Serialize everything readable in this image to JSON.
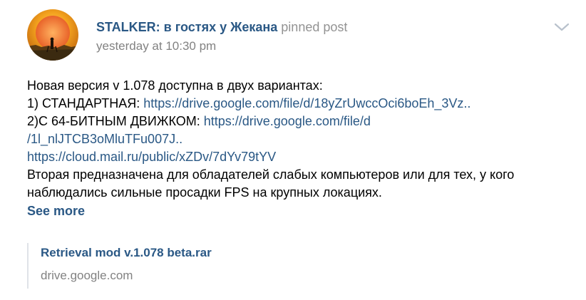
{
  "post": {
    "author": "STALKER: в гостях у Жекана",
    "pinned_label": "pinned post",
    "date": "yesterday at 10:30 pm",
    "avatar_icon": "group-avatar-icon",
    "menu_icon": "chevron-down-icon",
    "lines": [
      {
        "text": "Новая версия v 1.078 доступна в двух вариантах:"
      },
      {
        "text": "1) СТАНДАРТНАЯ: ",
        "link": "https://drive.google.com/file/d/18yZrUwccOci6boEh_3Vz.."
      },
      {
        "text": "2)С 64-БИТНЫМ ДВИЖКОМ: ",
        "link": "https://drive.google.com/file/d"
      },
      {
        "text": "",
        "link": "/1l_nlJTCB3oMluTFu007J.."
      },
      {
        "text": "",
        "link": "https://cloud.mail.ru/public/xZDv/7dYv79tYV"
      },
      {
        "text": "Вторая предназначена для обладателей слабых компьютеров или для тех, у кого"
      },
      {
        "text": "наблюдались сильные просадки FPS на крупных локациях."
      }
    ],
    "see_more": "See more",
    "attachment": {
      "title": "Retrieval mod v.1.078 beta.rar",
      "domain": "drive.google.com"
    }
  },
  "colors": {
    "link": "#2a5885",
    "muted": "#828282",
    "pinned": "#939393",
    "avatar_sky": "#f0a020",
    "avatar_sun": "#ff8a2a"
  }
}
